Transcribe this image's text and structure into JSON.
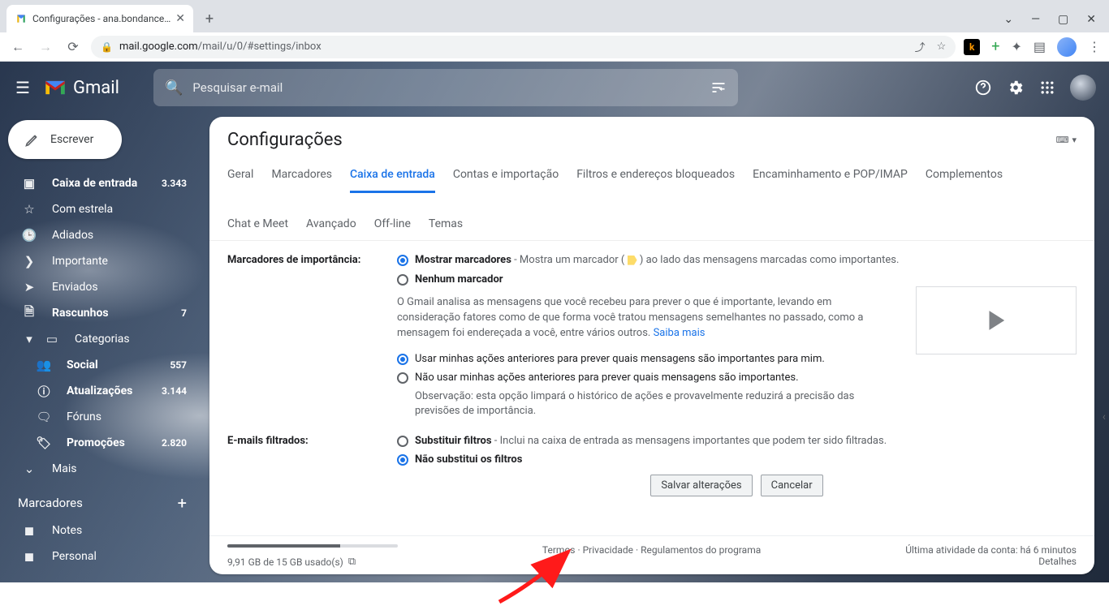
{
  "browser": {
    "tab_title": "Configurações - ana.bondance@",
    "url_host": "mail.google.com",
    "url_path": "/mail/u/0/#settings/inbox"
  },
  "header": {
    "product": "Gmail",
    "search_placeholder": "Pesquisar e-mail"
  },
  "compose_label": "Escrever",
  "sidebar": {
    "items": [
      {
        "icon": "inbox",
        "label": "Caixa de entrada",
        "count": "3.343",
        "bold": true
      },
      {
        "icon": "star",
        "label": "Com estrela"
      },
      {
        "icon": "clock",
        "label": "Adiados"
      },
      {
        "icon": "important",
        "label": "Importante"
      },
      {
        "icon": "send",
        "label": "Enviados"
      },
      {
        "icon": "draft",
        "label": "Rascunhos",
        "count": "7",
        "bold": true
      },
      {
        "icon": "category",
        "label": "Categorias",
        "expand": true
      },
      {
        "icon": "people",
        "label": "Social",
        "count": "557",
        "bold": true,
        "sub": true
      },
      {
        "icon": "info",
        "label": "Atualizações",
        "count": "3.144",
        "bold": true,
        "sub": true
      },
      {
        "icon": "forum",
        "label": "Fóruns",
        "sub": true
      },
      {
        "icon": "tag",
        "label": "Promoções",
        "count": "2.820",
        "bold": true,
        "sub": true
      },
      {
        "icon": "more",
        "label": "Mais",
        "expand": true
      }
    ],
    "labels_header": "Marcadores",
    "labels": [
      {
        "label": "Notes"
      },
      {
        "label": "Personal"
      }
    ]
  },
  "settings": {
    "title": "Configurações",
    "tabs": [
      "Geral",
      "Marcadores",
      "Caixa de entrada",
      "Contas e importação",
      "Filtros e endereços bloqueados",
      "Encaminhamento e POP/IMAP",
      "Complementos",
      "Chat e Meet",
      "Avançado",
      "Off-line",
      "Temas"
    ],
    "active_tab": "Caixa de entrada",
    "importance": {
      "label": "Marcadores de importância:",
      "opt1": "Mostrar marcadores",
      "opt1_desc": " - Mostra um marcador ( ",
      "opt1_desc2": " ) ao lado das mensagens marcadas como importantes.",
      "opt2": "Nenhum marcador",
      "explain": "O Gmail analisa as mensagens que você recebeu para prever o que é importante, levando em consideração fatores como de que forma você tratou mensagens semelhantes no passado, como a mensagem foi endereçada a você, entre vários outros. ",
      "learn_more": "Saiba mais",
      "pred1": "Usar minhas ações anteriores para prever quais mensagens são importantes para mim.",
      "pred2": "Não usar minhas ações anteriores para prever quais mensagens são importantes.",
      "pred2_note": "Observação: esta opção limpará o histórico de ações e provavelmente reduzirá a precisão das previsões de importância."
    },
    "filtered": {
      "label": "E-mails filtrados:",
      "opt1": "Substituir filtros",
      "opt1_desc": " - Inclui na caixa de entrada as mensagens importantes que podem ter sido filtradas.",
      "opt2": "Não substitui os filtros"
    },
    "save_btn": "Salvar alterações",
    "cancel_btn": "Cancelar"
  },
  "footer": {
    "storage": "9,91 GB de 15 GB usado(s)",
    "links": "Termos · Privacidade · Regulamentos do programa",
    "activity": "Última atividade da conta: há 6 minutos",
    "details": "Detalhes"
  }
}
